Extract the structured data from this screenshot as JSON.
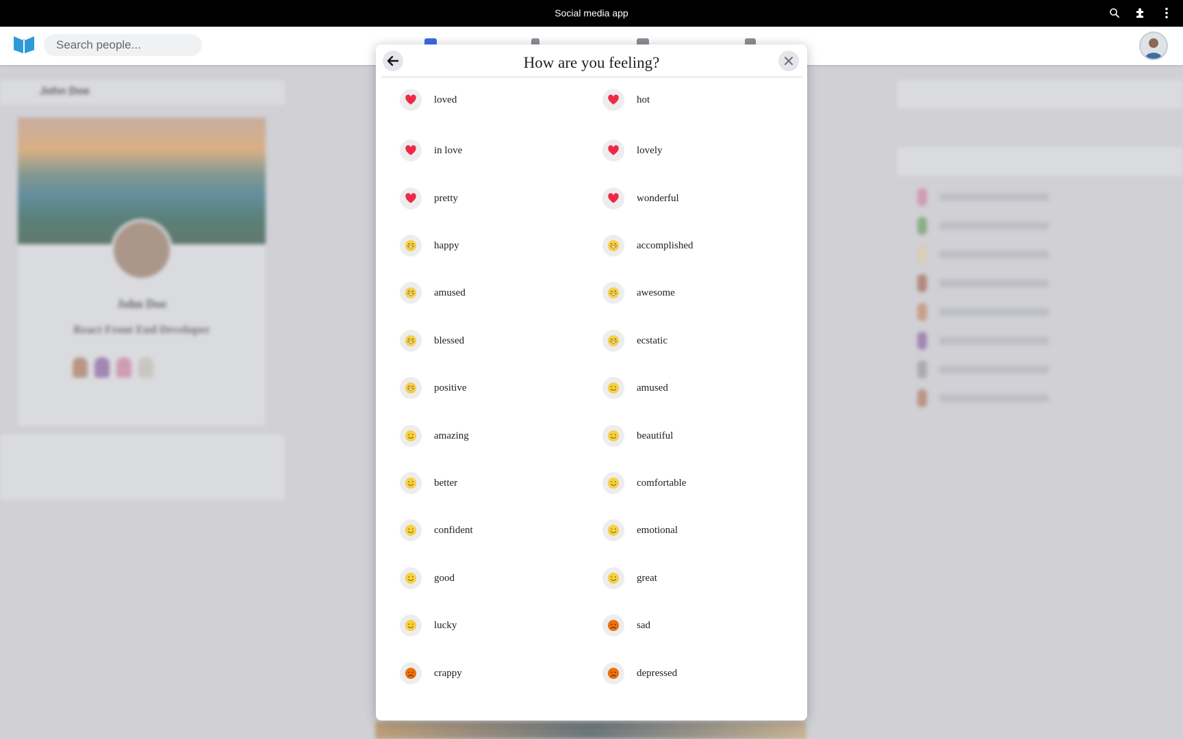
{
  "window": {
    "title": "Social media app"
  },
  "header": {
    "search_placeholder": "Search people...",
    "nav": [
      "home-icon",
      "person-icon",
      "group-icon",
      "watch-icon"
    ]
  },
  "background": {
    "profile_name": "John Doe",
    "profile_role": "React Front End Developer"
  },
  "modal": {
    "title": "How are you feeling?",
    "feelings": [
      {
        "label": "loved",
        "icon": "heart-icon"
      },
      {
        "label": "hot",
        "icon": "heart-icon"
      },
      {
        "label": "in love",
        "icon": "heart-icon"
      },
      {
        "label": "lovely",
        "icon": "heart-icon"
      },
      {
        "label": "pretty",
        "icon": "heart-icon"
      },
      {
        "label": "wonderful",
        "icon": "heart-icon"
      },
      {
        "label": "happy",
        "icon": "grin-icon"
      },
      {
        "label": "accomplished",
        "icon": "grin-icon"
      },
      {
        "label": "amused",
        "icon": "grin-icon"
      },
      {
        "label": "awesome",
        "icon": "grin-icon"
      },
      {
        "label": "blessed",
        "icon": "grin-icon"
      },
      {
        "label": "ecstatic",
        "icon": "grin-icon"
      },
      {
        "label": "positive",
        "icon": "grin-icon"
      },
      {
        "label": "amused",
        "icon": "smile-icon"
      },
      {
        "label": "amazing",
        "icon": "smile-icon"
      },
      {
        "label": "beautiful",
        "icon": "smile-icon"
      },
      {
        "label": "better",
        "icon": "smile-icon"
      },
      {
        "label": "comfortable",
        "icon": "smile-icon"
      },
      {
        "label": "confident",
        "icon": "smile-icon"
      },
      {
        "label": "emotional",
        "icon": "smile-icon"
      },
      {
        "label": "good",
        "icon": "smile-icon"
      },
      {
        "label": "great",
        "icon": "smile-icon"
      },
      {
        "label": "lucky",
        "icon": "smile-icon"
      },
      {
        "label": "sad",
        "icon": "sad-icon"
      },
      {
        "label": "crappy",
        "icon": "sad-icon"
      },
      {
        "label": "depressed",
        "icon": "sad-icon"
      }
    ]
  },
  "colors": {
    "heart": "#f02849",
    "grin": "#f7d046",
    "sad": "#e9710f",
    "logo": "#2e9bd6"
  }
}
